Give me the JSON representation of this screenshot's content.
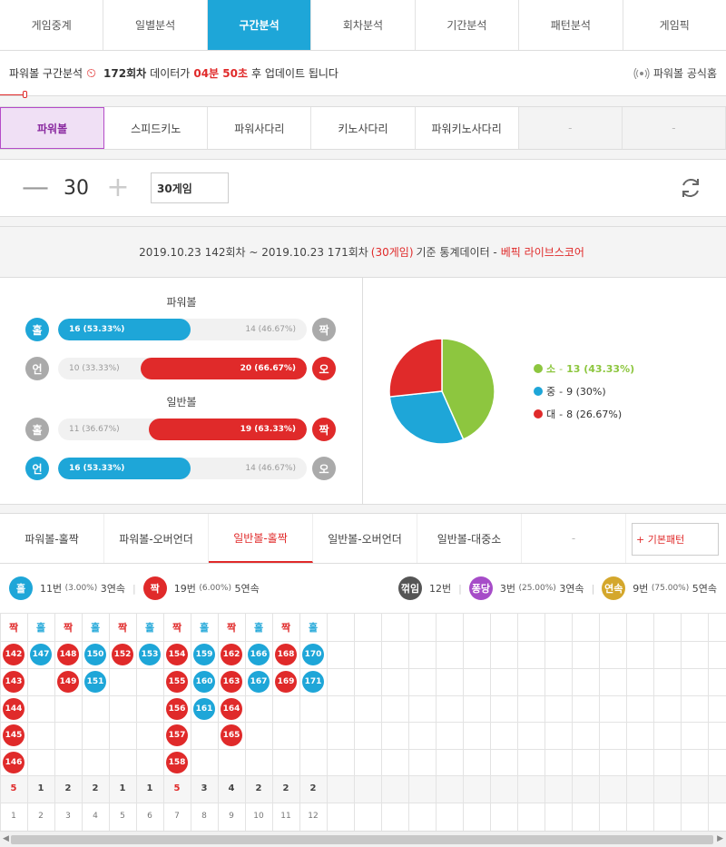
{
  "top_tabs": [
    "게임중계",
    "일별분석",
    "구간분석",
    "회차분석",
    "기간분석",
    "패턴분석",
    "게임픽"
  ],
  "notice": {
    "prefix": "파워볼 구간분석",
    "round": "172회차",
    "mid": "데이터가",
    "time": "04분 50초",
    "suffix": "후 업데이트 됩니다",
    "link": "파워볼 공식홈"
  },
  "game_tabs": [
    "파워볼",
    "스피드키노",
    "파워사다리",
    "키노사다리",
    "파워키노사다리",
    "-",
    "-"
  ],
  "counter": {
    "minus": "—",
    "value": "30",
    "plus": "+",
    "select": "30게임"
  },
  "stats": {
    "head_main": "2019.10.23 142회차 ~ 2019.10.23 171회차",
    "head_red": "(30게임)",
    "head_mid": "기준 통계데이터 -",
    "head_link": "베픽 라이브스코어",
    "group1": "파워볼",
    "group2": "일반볼",
    "rows": [
      {
        "left": "홀",
        "right": "짝",
        "win": "16 (53.33%)",
        "lose": "14 (46.67%)",
        "fill": 0.5333,
        "side": "left",
        "color": "blue"
      },
      {
        "left": "언",
        "right": "오",
        "win": "20 (66.67%)",
        "lose": "10 (33.33%)",
        "fill": 0.6667,
        "side": "right",
        "color": "red"
      },
      {
        "left": "홀",
        "right": "짝",
        "win": "19 (63.33%)",
        "lose": "11 (36.67%)",
        "fill": 0.6333,
        "side": "right",
        "color": "red"
      },
      {
        "left": "언",
        "right": "오",
        "win": "16 (53.33%)",
        "lose": "14 (46.67%)",
        "fill": 0.5333,
        "side": "left",
        "color": "blue"
      }
    ],
    "pie": [
      {
        "label": "소",
        "value": 13,
        "text": "13 (43.33%)",
        "color": "#8dc63f"
      },
      {
        "label": "중",
        "value": 9,
        "text": "9 (30%)",
        "color": "#1ea6d8"
      },
      {
        "label": "대",
        "value": 8,
        "text": "8 (26.67%)",
        "color": "#e02a2a"
      }
    ]
  },
  "pattern_tabs": [
    "파워볼-홀짝",
    "파워볼-오버언더",
    "일반볼-홀짝",
    "일반볼-오버언더",
    "일반볼-대중소",
    "-"
  ],
  "pattern_button": "+ 기본패턴",
  "summary": {
    "odd_label": "홀",
    "odd_count": "11번",
    "odd_pct": "(3.00%)",
    "odd_streak": "3연속",
    "even_label": "짝",
    "even_count": "19번",
    "even_pct": "(6.00%)",
    "even_streak": "5연속",
    "break_label": "꺾임",
    "break_count": "12번",
    "pong_label": "퐁당",
    "pong_count": "3번",
    "pong_pct": "(25.00%)",
    "pong_streak": "3연속",
    "streak_label": "연속",
    "streak_count": "9번",
    "streak_pct": "(75.00%)",
    "streak_streak": "5연속"
  },
  "grid": {
    "columns": [
      {
        "head": "짝",
        "color": "red",
        "rounds": [
          "142",
          "143",
          "144",
          "145",
          "146"
        ],
        "count": "5"
      },
      {
        "head": "홀",
        "color": "blue",
        "rounds": [
          "147"
        ],
        "count": "1"
      },
      {
        "head": "짝",
        "color": "red",
        "rounds": [
          "148",
          "149"
        ],
        "count": "2"
      },
      {
        "head": "홀",
        "color": "blue",
        "rounds": [
          "150",
          "151"
        ],
        "count": "2"
      },
      {
        "head": "짝",
        "color": "red",
        "rounds": [
          "152"
        ],
        "count": "1"
      },
      {
        "head": "홀",
        "color": "blue",
        "rounds": [
          "153"
        ],
        "count": "1"
      },
      {
        "head": "짝",
        "color": "red",
        "rounds": [
          "154",
          "155",
          "156",
          "157",
          "158"
        ],
        "count": "5"
      },
      {
        "head": "홀",
        "color": "blue",
        "rounds": [
          "159",
          "160",
          "161"
        ],
        "count": "3"
      },
      {
        "head": "짝",
        "color": "red",
        "rounds": [
          "162",
          "163",
          "164",
          "165"
        ],
        "count": "4"
      },
      {
        "head": "홀",
        "color": "blue",
        "rounds": [
          "166",
          "167"
        ],
        "count": "2"
      },
      {
        "head": "짝",
        "color": "red",
        "rounds": [
          "168",
          "169"
        ],
        "count": "2"
      },
      {
        "head": "홀",
        "color": "blue",
        "rounds": [
          "170",
          "171"
        ],
        "count": "2"
      }
    ],
    "indices": [
      "1",
      "2",
      "3",
      "4",
      "5",
      "6",
      "7",
      "8",
      "9",
      "10",
      "11",
      "12"
    ]
  },
  "colors": {
    "blue": "#1ea6d8",
    "red": "#e02a2a",
    "gray": "#aaaaaa",
    "green": "#8dc63f",
    "purple": "#a64cc8",
    "gold": "#d4a72c",
    "dark": "#555555"
  }
}
